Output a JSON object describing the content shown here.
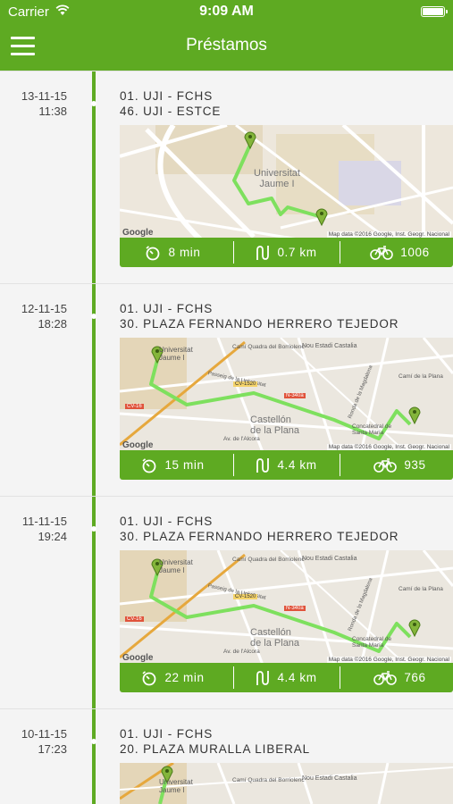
{
  "status_bar": {
    "carrier": "Carrier",
    "time": "9:09 AM"
  },
  "header": {
    "title": "Préstamos"
  },
  "colors": {
    "brand": "#5eaa22",
    "route": "#7ee05e",
    "marker": "#84b53b"
  },
  "icons": {
    "menu": "hamburger-icon",
    "time": "timer-icon",
    "distance": "route-icon",
    "bike": "bicycle-icon"
  },
  "loans": [
    {
      "date": "13-11-15",
      "time": "11:38",
      "origin": "01. UJI - FCHS",
      "destination": "46. UJI - ESTCE",
      "duration": "8 min",
      "distance": "0.7 km",
      "bike": "1006",
      "map": {
        "labels": [
          "Universitat",
          "Jaume I"
        ],
        "attribution": "Map data ©2016 Google, Inst. Geogr. Nacional",
        "logo": "Google"
      }
    },
    {
      "date": "12-11-15",
      "time": "18:28",
      "origin": "01. UJI - FCHS",
      "destination": "30. PLAZA FERNANDO HERRERO TEJEDOR",
      "duration": "15 min",
      "distance": "4.4 km",
      "bike": "935",
      "map": {
        "labels": [
          "Universitat",
          "Jaume I",
          "Camí Quadra del Borriolenc",
          "Nou Estadi Castalia",
          "Camí de la Plana",
          "Castellón",
          "de la Plana",
          "Concatedral de",
          "Santa María",
          "Av. de l'Alcora",
          "Passeig de la Universitat",
          "Ronda de la Magdalena"
        ],
        "roads": [
          "CV-1520",
          "N-340a",
          "CV-16"
        ],
        "attribution": "Map data ©2016 Google, Inst. Geogr. Nacional",
        "logo": "Google"
      }
    },
    {
      "date": "11-11-15",
      "time": "19:24",
      "origin": "01. UJI - FCHS",
      "destination": "30. PLAZA FERNANDO HERRERO TEJEDOR",
      "duration": "22 min",
      "distance": "4.4 km",
      "bike": "766",
      "map": {
        "labels": [
          "Universitat",
          "Jaume I",
          "Camí Quadra del Borriolenc",
          "Nou Estadi Castalia",
          "Camí de la Plana",
          "Castellón",
          "de la Plana",
          "Concatedral de",
          "Santa María",
          "Av. de l'Alcora",
          "Passeig de la Universitat",
          "Ronda de la Magdalena"
        ],
        "roads": [
          "CV-1520",
          "N-340a",
          "CV-16"
        ],
        "attribution": "Map data ©2016 Google, Inst. Geogr. Nacional",
        "logo": "Google"
      }
    },
    {
      "date": "10-11-15",
      "time": "17:23",
      "origin": "01. UJI - FCHS",
      "destination": "20. PLAZA MURALLA LIBERAL",
      "map": {
        "labels": [
          "Universitat",
          "Jaume I",
          "Camí Quadra del Borriolenc",
          "Nou Estadi Castalia"
        ]
      }
    }
  ]
}
